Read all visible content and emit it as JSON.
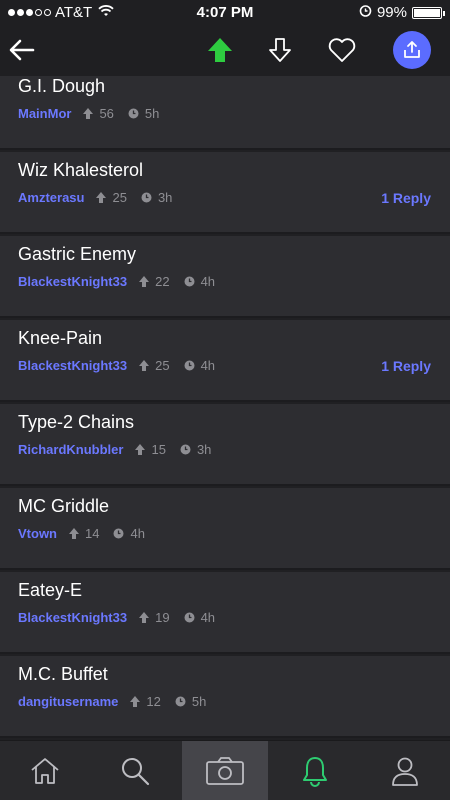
{
  "status_bar": {
    "carrier": "AT&T",
    "time": "4:07 PM",
    "battery": "99%",
    "battery_level": 0.99
  },
  "nav": {
    "back_icon": "back-arrow-icon",
    "upvote_icon": "upvote-arrow-icon",
    "downvote_icon": "downvote-arrow-icon",
    "favorite_icon": "heart-icon",
    "share_icon": "share-icon",
    "upvote_active_color": "#2ecc40",
    "share_bg_color": "#5b6cff"
  },
  "comments": [
    {
      "title": "G.I. Dough",
      "author": "MainMor",
      "votes": "56",
      "age": "5h",
      "replies": ""
    },
    {
      "title": "Wiz Khalesterol",
      "author": "Amzterasu",
      "votes": "25",
      "age": "3h",
      "replies": "1 Reply"
    },
    {
      "title": "Gastric Enemy",
      "author": "BlackestKnight33",
      "votes": "22",
      "age": "4h",
      "replies": ""
    },
    {
      "title": "Knee-Pain",
      "author": "BlackestKnight33",
      "votes": "25",
      "age": "4h",
      "replies": "1 Reply"
    },
    {
      "title": "Type-2 Chains",
      "author": "RichardKnubbler",
      "votes": "15",
      "age": "3h",
      "replies": ""
    },
    {
      "title": "MC Griddle",
      "author": "Vtown",
      "votes": "14",
      "age": "4h",
      "replies": ""
    },
    {
      "title": "Eatey-E",
      "author": "BlackestKnight33",
      "votes": "19",
      "age": "4h",
      "replies": ""
    },
    {
      "title": "M.C. Buffet",
      "author": "dangitusername",
      "votes": "12",
      "age": "5h",
      "replies": ""
    }
  ],
  "tabs": [
    {
      "name": "home",
      "icon": "home-icon"
    },
    {
      "name": "search",
      "icon": "search-icon"
    },
    {
      "name": "camera",
      "icon": "camera-icon",
      "selected": true
    },
    {
      "name": "notifications",
      "icon": "bell-icon",
      "color": "#2ecc71"
    },
    {
      "name": "profile",
      "icon": "person-icon"
    }
  ]
}
